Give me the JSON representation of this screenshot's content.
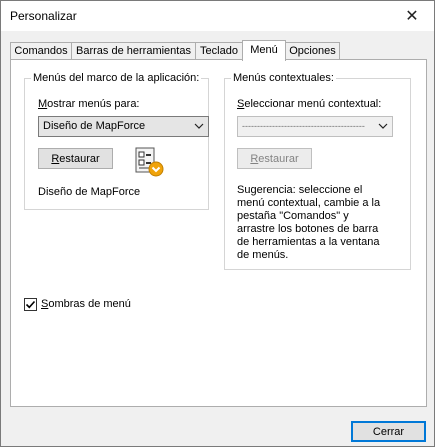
{
  "window": {
    "title": "Personalizar",
    "close_glyph": "✕"
  },
  "tabs": [
    {
      "label": "Comandos",
      "active": false
    },
    {
      "label": "Barras de herramientas",
      "active": false
    },
    {
      "label": "Teclado",
      "active": false
    },
    {
      "label": "Menú",
      "active": true
    },
    {
      "label": "Opciones",
      "active": false
    }
  ],
  "app_menus": {
    "legend": "Menús del marco de la aplicación:",
    "show_menus_label": "Mostrar menús para:",
    "selected_value": "Diseño de MapForce",
    "restore_button": "Restaurar",
    "current_menu_name": "Diseño de MapForce",
    "icon": "mapforce-design-icon"
  },
  "context_menus": {
    "legend": "Menús contextuales:",
    "select_label": "Seleccionar menú contextual:",
    "selected_value": "-----------------------------------------",
    "restore_button": "Restaurar",
    "hint": "Sugerencia: seleccione el menú contextual, cambie a la pestaña \"Comandos\" y arrastre los botones de barra de herramientas a la ventana de menús."
  },
  "menu_shadows": {
    "label": "Sombras de menú",
    "checked": true
  },
  "footer": {
    "close_button": "Cerrar"
  }
}
